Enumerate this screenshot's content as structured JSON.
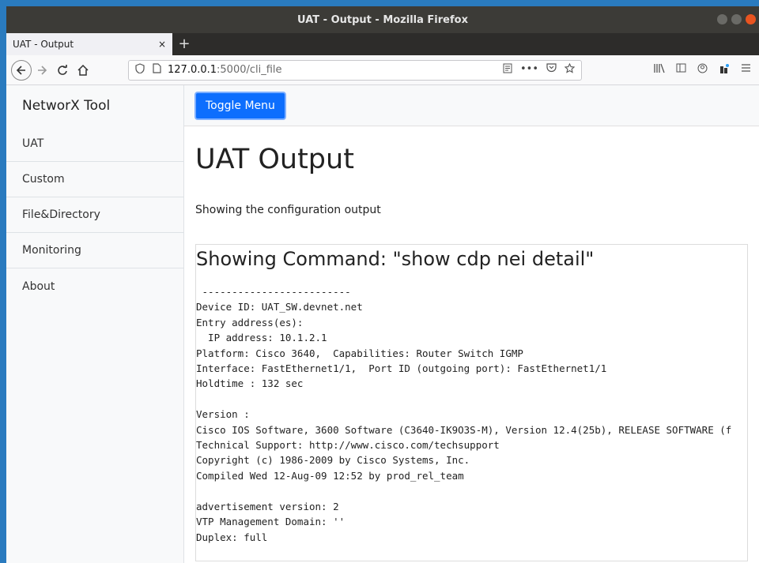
{
  "window": {
    "title": "UAT - Output - Mozilla Firefox"
  },
  "browser": {
    "tab_title": "UAT - Output",
    "tab_close": "×",
    "new_tab": "+",
    "url_host": "127.0.0.1",
    "url_rest": ":5000/cli_file"
  },
  "sidebar": {
    "brand": "NetworX Tool",
    "items": [
      {
        "label": "UAT"
      },
      {
        "label": "Custom"
      },
      {
        "label": "File&Directory"
      },
      {
        "label": "Monitoring"
      },
      {
        "label": "About"
      }
    ]
  },
  "main": {
    "toggle_label": "Toggle Menu",
    "title": "UAT Output",
    "subtitle": "Showing the configuration output",
    "command_title": "Showing Command: \"show cdp nei detail\"",
    "output": " -------------------------\nDevice ID: UAT_SW.devnet.net\nEntry address(es):\n  IP address: 10.1.2.1\nPlatform: Cisco 3640,  Capabilities: Router Switch IGMP\nInterface: FastEthernet1/1,  Port ID (outgoing port): FastEthernet1/1\nHoldtime : 132 sec\n\nVersion :\nCisco IOS Software, 3600 Software (C3640-IK9O3S-M), Version 12.4(25b), RELEASE SOFTWARE (f\nTechnical Support: http://www.cisco.com/techsupport\nCopyright (c) 1986-2009 by Cisco Systems, Inc.\nCompiled Wed 12-Aug-09 12:52 by prod_rel_team\n\nadvertisement version: 2\nVTP Management Domain: ''\nDuplex: full"
  }
}
